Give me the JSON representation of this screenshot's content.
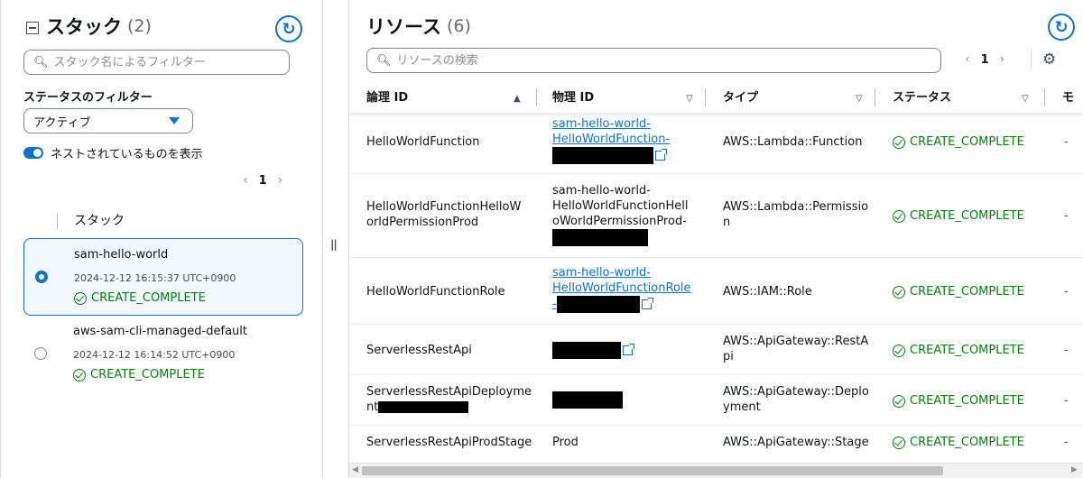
{
  "stacks_panel": {
    "title": "スタック",
    "count": "(2)",
    "search_placeholder": "スタック名によるフィルター",
    "status_filter_label": "ステータスのフィルター",
    "status_filter_value": "アクティブ",
    "nested_toggle_label": "ネストされているものを表示",
    "nested_toggle_on": true,
    "page": "1",
    "column_header": "スタック",
    "items": [
      {
        "name": "sam-hello-world",
        "date": "2024-12-12 16:15:37 UTC+0900",
        "status": "CREATE_COMPLETE",
        "selected": true
      },
      {
        "name": "aws-sam-cli-managed-default",
        "date": "2024-12-12 16:14:52 UTC+0900",
        "status": "CREATE_COMPLETE",
        "selected": false
      }
    ]
  },
  "resources_panel": {
    "title": "リソース",
    "count": "(6)",
    "search_placeholder": "リソースの検索",
    "page": "1",
    "columns": [
      "論理 ID",
      "物理 ID",
      "タイプ",
      "ステータス",
      "モ"
    ],
    "rows": [
      {
        "logical": "HelloWorldFunction",
        "physical_lines": [
          "sam-hello-world-",
          "HelloWorldFunction-"
        ],
        "physical_link": true,
        "type_lines": [
          "AWS::Lambda::Function"
        ],
        "status": "CREATE_COMPLETE",
        "extra": "-"
      },
      {
        "logical_lines": [
          "HelloWorldFunctionHelloW",
          "orldPermissionProd"
        ],
        "physical_lines": [
          "sam-hello-world-",
          "HelloWorldFunctionHell",
          "oWorldPermissionProd-"
        ],
        "physical_link": false,
        "type_lines": [
          "AWS::Lambda::Permissio",
          "n"
        ],
        "status": "CREATE_COMPLETE",
        "extra": "-"
      },
      {
        "logical": "HelloWorldFunctionRole",
        "physical_lines": [
          "sam-hello-world-",
          "HelloWorldFunctionRole",
          "-"
        ],
        "physical_link": true,
        "type_lines": [
          "AWS::IAM::Role"
        ],
        "status": "CREATE_COMPLETE",
        "extra": "-"
      },
      {
        "logical": "ServerlessRestApi",
        "physical_lines": [],
        "physical_link": true,
        "type_lines": [
          "AWS::ApiGateway::RestA",
          "pi"
        ],
        "status": "CREATE_COMPLETE",
        "extra": "-"
      },
      {
        "logical_lines": [
          "ServerlessRestApiDeployme",
          "nt"
        ],
        "physical_lines": [],
        "physical_link": false,
        "type_lines": [
          "AWS::ApiGateway::Deplo",
          "yment"
        ],
        "status": "CREATE_COMPLETE",
        "extra": "-"
      },
      {
        "logical": "ServerlessRestApiProdStage",
        "physical_lines": [
          "Prod"
        ],
        "physical_link": false,
        "type_lines": [
          "AWS::ApiGateway::Stage"
        ],
        "status": "CREATE_COMPLETE",
        "extra": "-"
      }
    ]
  },
  "colors": {
    "accent": "#0972d3",
    "success": "#037f0c"
  },
  "icons": [
    "collapse-icon",
    "refresh-icon",
    "search-icon",
    "caret-down-icon",
    "chevron-left-icon",
    "chevron-right-icon",
    "check-circle-icon",
    "external-link-icon",
    "settings-gear-icon",
    "sort-asc-icon",
    "sort-desc-icon",
    "splitter-handle-icon"
  ]
}
